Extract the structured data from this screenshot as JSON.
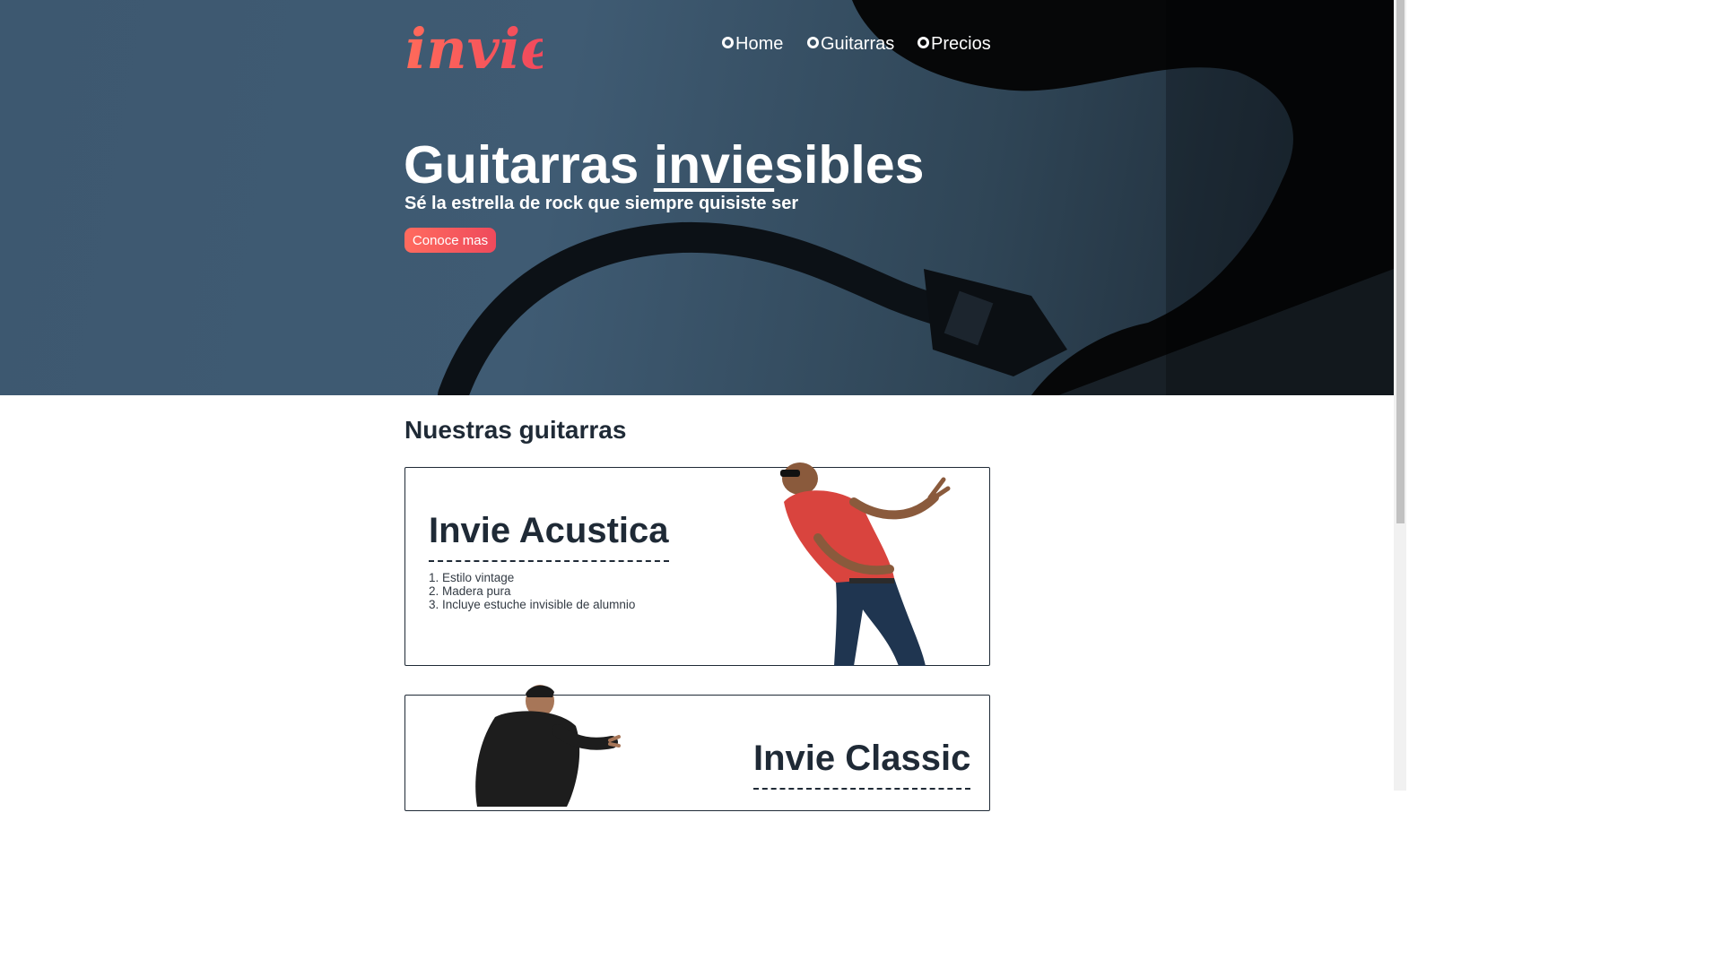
{
  "brand": {
    "logo_text": "invie",
    "color": "#f4505a"
  },
  "nav": {
    "items": [
      {
        "label": "Home"
      },
      {
        "label": "Guitarras"
      },
      {
        "label": "Precios"
      }
    ]
  },
  "hero": {
    "title_pre": "Guitarras ",
    "title_underlined": "invie",
    "title_post": "sibles",
    "subtitle": "Sé la estrella de rock que siempre quisiste ser",
    "cta_label": "Conoce mas"
  },
  "section": {
    "title": "Nuestras guitarras"
  },
  "guitars": [
    {
      "name": "Invie Acustica",
      "features": [
        "1. Estilo vintage",
        "2. Madera pura",
        "3. Incluye estuche invisible de alumnio"
      ]
    },
    {
      "name": "Invie Classic"
    }
  ],
  "colors": {
    "hero_bg": "#3d5870",
    "accent": "#f4505a",
    "text_dark": "#1f2a36"
  }
}
